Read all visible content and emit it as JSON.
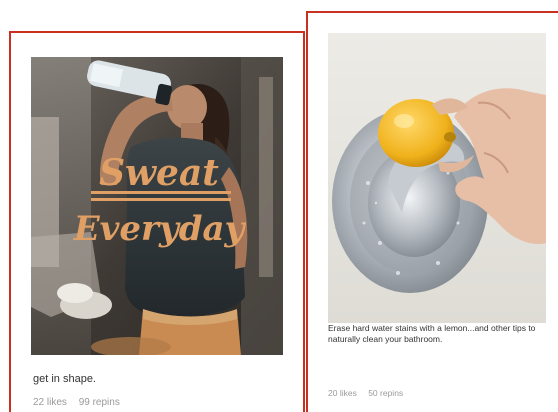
{
  "pins": [
    {
      "overlay_line_1": "Sweat",
      "overlay_line_2": "Everyday",
      "description": "get in shape.",
      "likes": "22 likes",
      "repins": "99 repins",
      "colors": {
        "border": "#c8311f",
        "overlay_text": "#e0a065"
      }
    },
    {
      "description": "Erase hard water stains with a lemon...and other tips to naturally clean your bathroom.",
      "likes": "20 likes",
      "repins": "50 repins",
      "colors": {
        "border": "#c8311f"
      }
    }
  ]
}
